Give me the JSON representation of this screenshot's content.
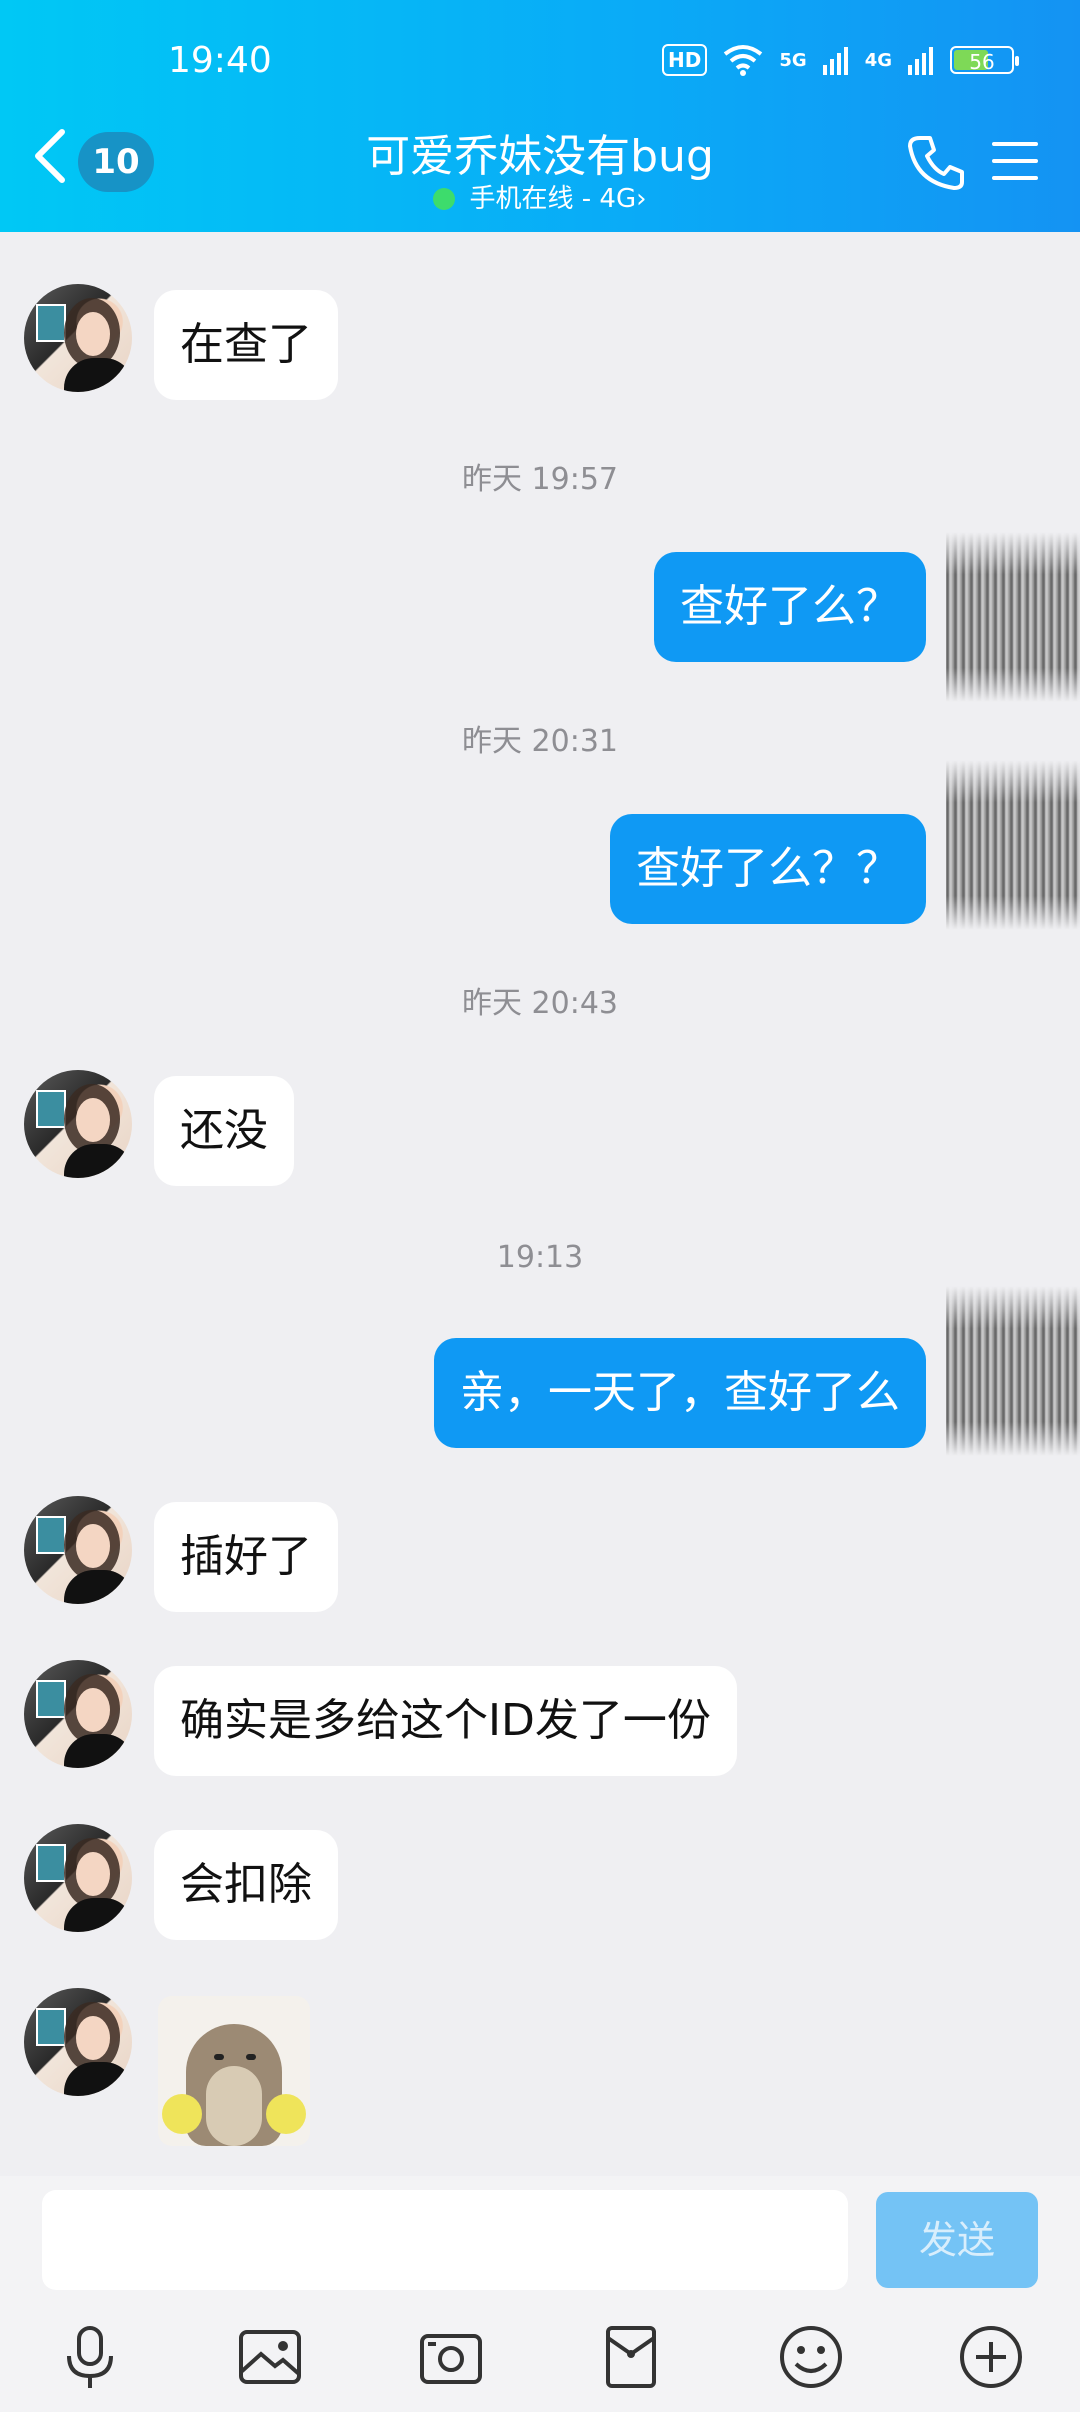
{
  "status_bar": {
    "time": "19:40",
    "hd": "HD",
    "net5g": "5G",
    "net4g": "4G",
    "battery": "56"
  },
  "header": {
    "unread_count": "10",
    "title": "可爱乔妹没有bug",
    "status": "手机在线 - 4G",
    "status_arrow": "›"
  },
  "messages": [
    {
      "side": "left",
      "text": "在查了"
    },
    {
      "timestamp": "昨天 19:57"
    },
    {
      "side": "right",
      "text": "查好了么？"
    },
    {
      "timestamp": "昨天 20:31"
    },
    {
      "side": "right",
      "text": "查好了么？？"
    },
    {
      "timestamp": "昨天 20:43"
    },
    {
      "side": "left",
      "text": "还没"
    },
    {
      "timestamp": "19:13"
    },
    {
      "side": "right",
      "text": "亲，一天了，查好了么"
    },
    {
      "side": "left",
      "text": "插好了"
    },
    {
      "side": "left",
      "text": "确实是多给这个ID发了一份"
    },
    {
      "side": "left",
      "text": "会扣除"
    },
    {
      "side": "left",
      "type": "sticker",
      "sticker": "otter-sticker"
    }
  ],
  "input": {
    "placeholder": "",
    "send_label": "发送"
  },
  "toolbar": [
    "mic-icon",
    "image-icon",
    "camera-icon",
    "red-packet-icon",
    "emoji-icon",
    "plus-icon"
  ],
  "colors": {
    "accent": "#0f99f4",
    "header": "#0aaaf7",
    "online": "#3ddc6c"
  }
}
